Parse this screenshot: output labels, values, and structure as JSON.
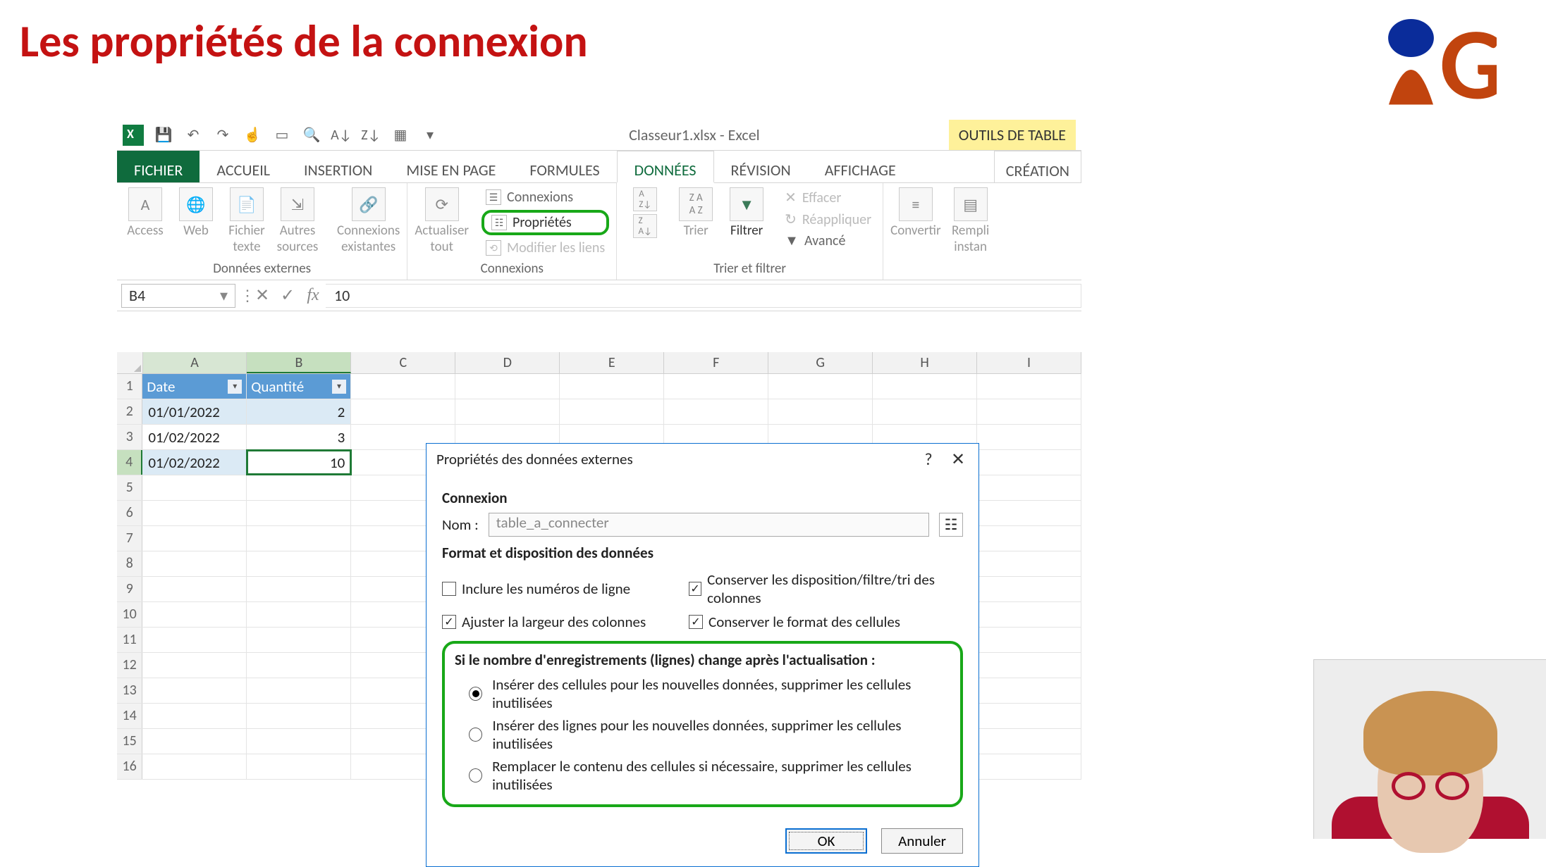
{
  "slide": {
    "title": "Les propriétés de la connexion"
  },
  "qat": {
    "doc_title": "Classeur1.xlsx - Excel",
    "tool_tab": "OUTILS DE TABLE"
  },
  "tabs": {
    "file": "FICHIER",
    "home": "ACCUEIL",
    "insert": "INSERTION",
    "layout": "MISE EN PAGE",
    "formulas": "FORMULES",
    "data": "DONNÉES",
    "review": "RÉVISION",
    "view": "AFFICHAGE",
    "design": "CRÉATION"
  },
  "ribbon": {
    "ext": {
      "access": "Access",
      "web": "Web",
      "fichier_texte": "Fichier\ntexte",
      "autres_sources": "Autres\nsources",
      "connexions_existantes": "Connexions\nexistantes",
      "group": "Données externes"
    },
    "conn": {
      "actualiser": "Actualiser\ntout",
      "connexions": "Connexions",
      "proprietes": "Propriétés",
      "modifier": "Modifier les liens",
      "group": "Connexions"
    },
    "sort": {
      "trier": "Trier",
      "filtrer": "Filtrer",
      "effacer": "Effacer",
      "reapp": "Réappliquer",
      "avance": "Avancé",
      "group": "Trier et filtrer"
    },
    "tools": {
      "convertir": "Convertir",
      "remplir": "Rempli\ninstan"
    }
  },
  "formula": {
    "name": "B4",
    "value": "10"
  },
  "cols": [
    "A",
    "B",
    "C",
    "D",
    "E",
    "F",
    "G",
    "H",
    "I"
  ],
  "table": {
    "headers": [
      "Date",
      "Quantité"
    ],
    "rows": [
      {
        "date": "01/01/2022",
        "q": "2"
      },
      {
        "date": "01/02/2022",
        "q": "3"
      },
      {
        "date": "01/02/2022",
        "q": "10"
      }
    ]
  },
  "rownums": [
    "1",
    "2",
    "3",
    "4",
    "5",
    "6",
    "7",
    "8",
    "9",
    "10",
    "11",
    "12",
    "13",
    "14",
    "15",
    "16"
  ],
  "dialog": {
    "title": "Propriétés des données externes",
    "help": "?",
    "close": "✕",
    "s1": "Connexion",
    "name_label": "Nom :",
    "name_value": "table_a_connecter",
    "s2": "Format et disposition des données",
    "chk_num": "Inclure les numéros de ligne",
    "chk_disp": "Conserver les disposition/filtre/tri des colonnes",
    "chk_width": "Ajuster la largeur des colonnes",
    "chk_format": "Conserver le format des cellules",
    "s3": "Si le nombre d'enregistrements (lignes) change après l'actualisation :",
    "r1": "Insérer des cellules pour les nouvelles données, supprimer les cellules inutilisées",
    "r2": "Insérer des lignes pour les nouvelles données, supprimer les cellules inutilisées",
    "r3": "Remplacer le contenu des cellules si nécessaire, supprimer les cellules inutilisées",
    "ok": "OK",
    "cancel": "Annuler"
  }
}
